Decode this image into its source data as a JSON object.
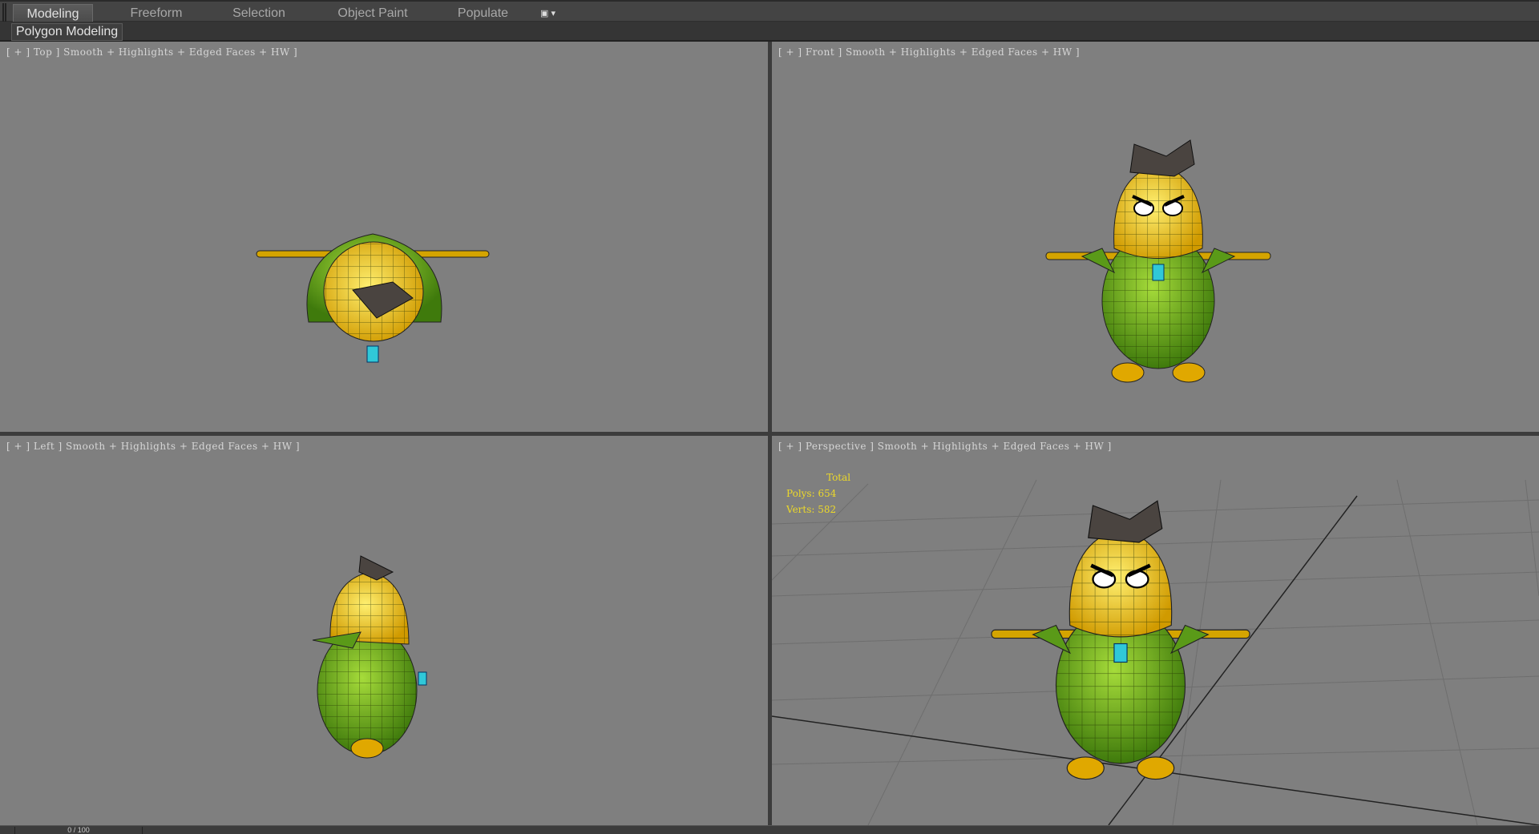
{
  "ribbon": {
    "tabs": [
      {
        "label": "Modeling",
        "active": true
      },
      {
        "label": "Freeform"
      },
      {
        "label": "Selection"
      },
      {
        "label": "Object Paint"
      },
      {
        "label": "Populate"
      }
    ],
    "more_icon": "display-dropdown-icon",
    "panel": "Polygon Modeling"
  },
  "viewports": {
    "top": {
      "label": "[ + ] Top ] Smooth + Highlights + Edged Faces + HW ]"
    },
    "front": {
      "label": "[ + ] Front ] Smooth + Highlights + Edged Faces + HW ]"
    },
    "left": {
      "label": "[ + ] Left ] Smooth + Highlights + Edged Faces + HW ]"
    },
    "perspective": {
      "label": "[ + ] Perspective ] Smooth + Highlights + Edged Faces + HW ]",
      "stats": {
        "title": "Total",
        "polys": "Polys: 654",
        "verts": "Verts: 582"
      }
    }
  },
  "timeline": {
    "frame": "0 / 100"
  },
  "colors": {
    "viewport_bg": "#7f7f7f",
    "stats": "#ecd82a",
    "body_green": "#6fae1c",
    "head_yellow": "#f2c200",
    "hair": "#4a4440"
  }
}
